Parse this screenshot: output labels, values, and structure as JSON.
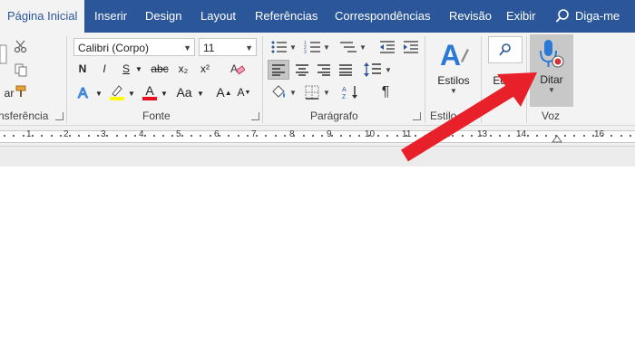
{
  "tabs": [
    "Página Inicial",
    "Inserir",
    "Design",
    "Layout",
    "Referências",
    "Correspondências",
    "Revisão",
    "Exibir"
  ],
  "tell_me": "Diga-me",
  "font": {
    "name": "Calibri (Corpo)",
    "size": "11"
  },
  "groups": {
    "clipboard": "nsferência",
    "font": "Fonte",
    "paragraph": "Parágrafo",
    "styles": "Estilo",
    "voice": "Voz"
  },
  "buttons": {
    "bold": "N",
    "italic": "I",
    "underline": "S",
    "strike": "abc",
    "subscript": "x₂",
    "superscript": "x²",
    "font_color_letter": "A",
    "change_case": "Aa",
    "styles": "Estilos",
    "editing": "Edi",
    "dictate": "Ditar",
    "paste_partial": "ar"
  },
  "ruler": {
    "labels": [
      "1",
      "2",
      "3",
      "4",
      "5",
      "6",
      "7",
      "8",
      "9",
      "10",
      "11",
      "12",
      "13",
      "14",
      "16"
    ]
  },
  "colors": {
    "accent": "#2b579a",
    "highlight": "#ffff00",
    "font_color": "#e81123",
    "arrow": "#e8202a"
  }
}
